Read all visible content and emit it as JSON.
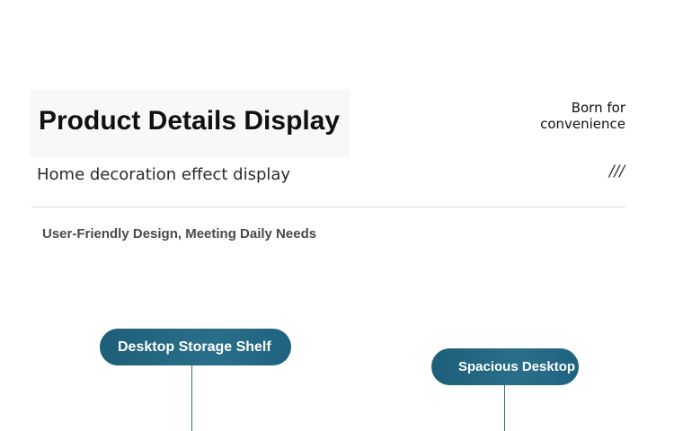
{
  "header": {
    "title": "Product Details Display",
    "tagline_line1": "Born for",
    "tagline_line2": "convenience",
    "subtitle": "Home decoration effect display",
    "slashes": "///"
  },
  "feature": {
    "heading": "User-Friendly Design, Meeting Daily Needs"
  },
  "callouts": [
    {
      "label": "Desktop Storage Shelf"
    },
    {
      "label": "Spacious Desktop"
    }
  ],
  "colors": {
    "pill": "#1f6280",
    "divider": "#dedede"
  }
}
